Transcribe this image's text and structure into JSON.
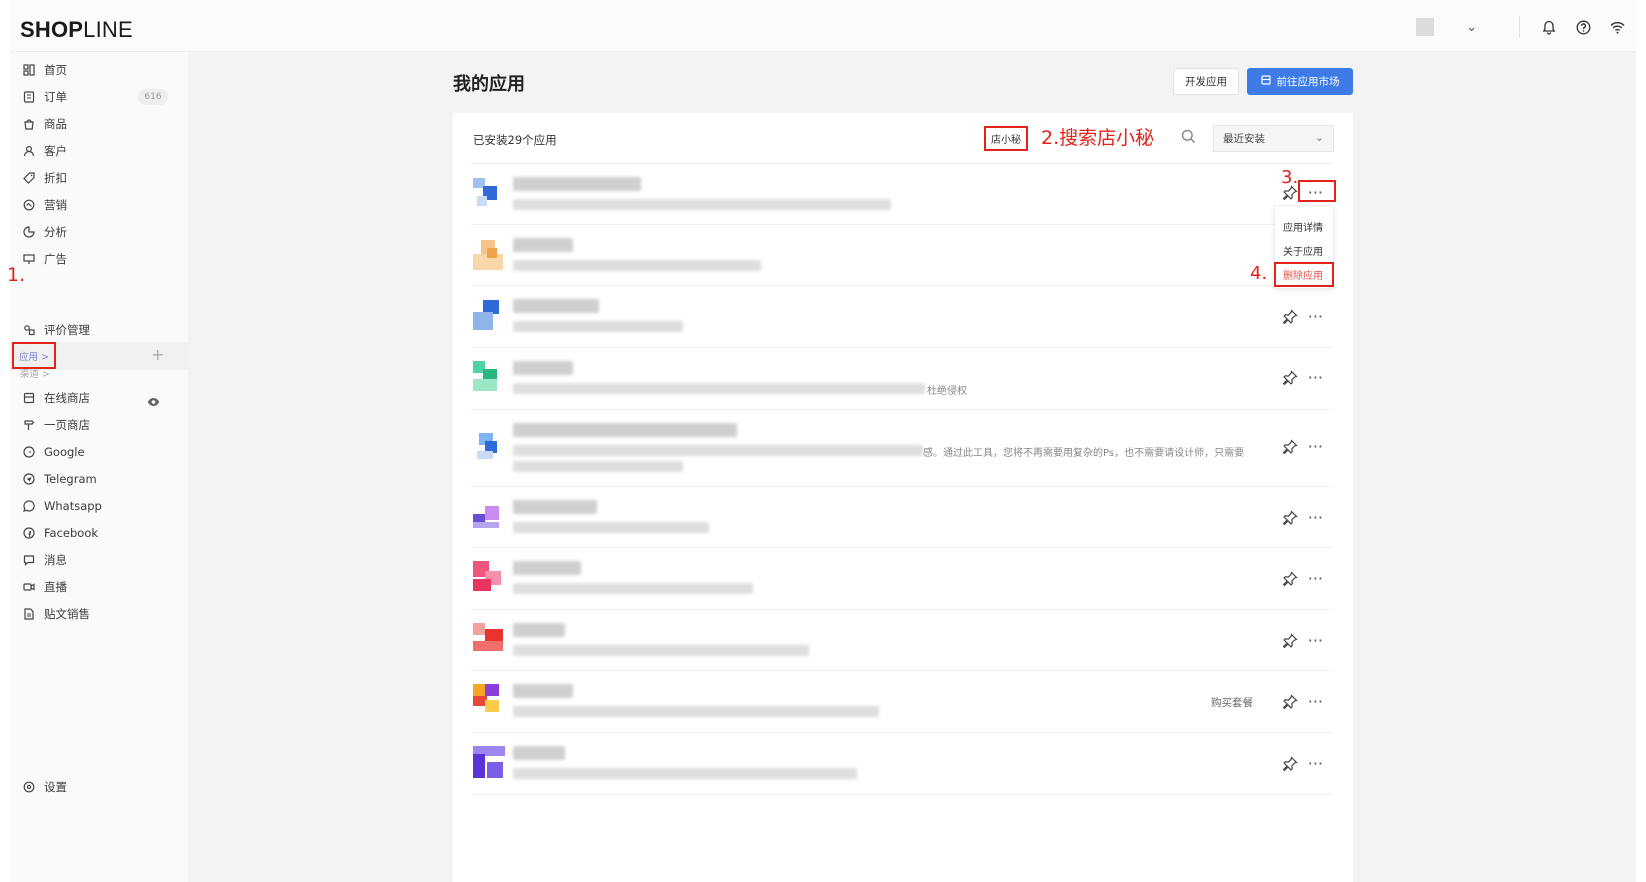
{
  "brand": {
    "logo_bold": "SHOP",
    "logo_light": "LINE"
  },
  "topbar": {
    "icons": [
      "chevron-down-icon",
      "bell-icon",
      "help-icon",
      "wifi-icon"
    ]
  },
  "sidebar": {
    "items": [
      {
        "label": "首页",
        "icon": "dashboard-icon"
      },
      {
        "label": "订单",
        "icon": "order-icon",
        "badge": "616"
      },
      {
        "label": "商品",
        "icon": "bag-icon"
      },
      {
        "label": "客户",
        "icon": "user-icon"
      },
      {
        "label": "折扣",
        "icon": "tag-icon"
      },
      {
        "label": "营销",
        "icon": "marketing-icon"
      },
      {
        "label": "分析",
        "icon": "chart-icon"
      },
      {
        "label": "广告",
        "icon": "ad-icon"
      }
    ],
    "apps_label": "应用 >",
    "reviews_label": "评价管理",
    "channels_label": "渠道 >",
    "channels": [
      {
        "label": "在线商店",
        "icon": "store-icon"
      },
      {
        "label": "一页商店",
        "icon": "signpost-icon"
      },
      {
        "label": "Google",
        "icon": "google-icon"
      },
      {
        "label": "Telegram",
        "icon": "telegram-icon"
      },
      {
        "label": "Whatsapp",
        "icon": "whatsapp-icon"
      },
      {
        "label": "Facebook",
        "icon": "facebook-icon"
      },
      {
        "label": "消息",
        "icon": "message-icon"
      },
      {
        "label": "直播",
        "icon": "live-icon"
      },
      {
        "label": "贴文销售",
        "icon": "post-icon"
      }
    ],
    "settings_label": "设置"
  },
  "annotations": {
    "step1": "1.",
    "step2": "2.搜索店小秘",
    "step3": "3.",
    "step4": "4."
  },
  "main": {
    "title": "我的应用",
    "dev_button": "开发应用",
    "market_button": "前往应用市场",
    "installed_count": "已安装29个应用",
    "search_chip": "店小秘",
    "sort_value": "最近安装",
    "row_texts": {
      "row4_desc_tail": "杜绝侵权",
      "row5_desc_tail": "感。通过此工具，您将不再需要用复杂的Ps，也不需要请设计师，只需要",
      "buy_label": "购买套餐"
    },
    "menu": {
      "detail": "应用详情",
      "about": "关于应用",
      "delete": "删除应用"
    }
  },
  "colors": {
    "accent": "#3f7be6",
    "annotation": "#e2231a",
    "danger": "#e5534b"
  }
}
